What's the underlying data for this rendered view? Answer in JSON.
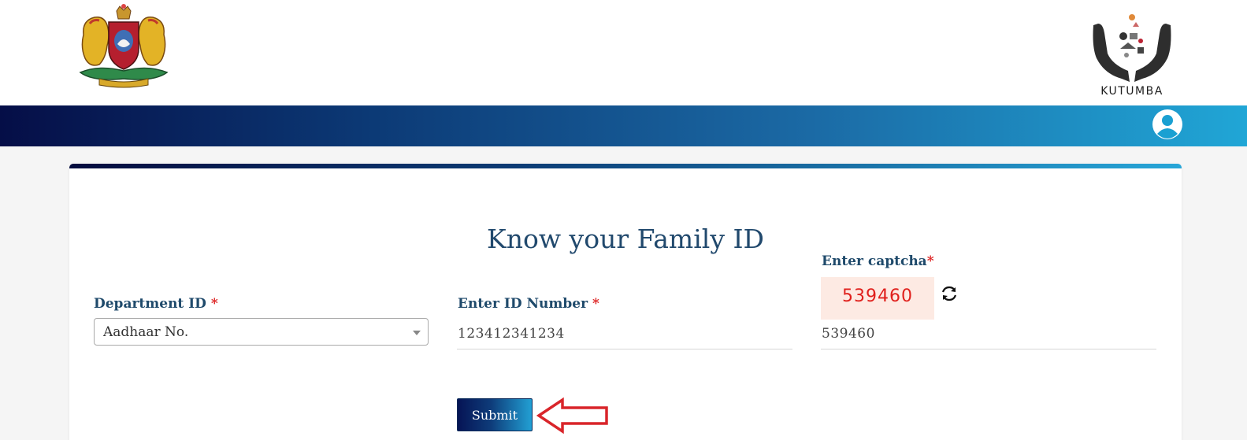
{
  "header": {
    "emblem_icon": "karnataka-emblem-icon",
    "logo_icon": "kutumba-logo-icon",
    "logo_text": "KUTUMBA"
  },
  "navbar": {
    "user_icon": "user-avatar-icon"
  },
  "form": {
    "title": "Know your Family ID",
    "required_mark": "*",
    "department": {
      "label": "Department ID",
      "value": "Aadhaar No."
    },
    "id_number": {
      "label": "Enter ID Number",
      "value": "123412341234"
    },
    "captcha": {
      "label": "Enter captcha",
      "image_text": "539460",
      "value": "539460",
      "refresh_icon": "refresh-icon"
    },
    "submit_label": "Submit"
  },
  "annotation": {
    "icon": "red-arrow-left-icon",
    "color": "#d9252a"
  },
  "colors": {
    "navy": "#050e47",
    "cyan": "#20a6d6",
    "label": "#1f4a6b",
    "required": "#dd2222"
  }
}
